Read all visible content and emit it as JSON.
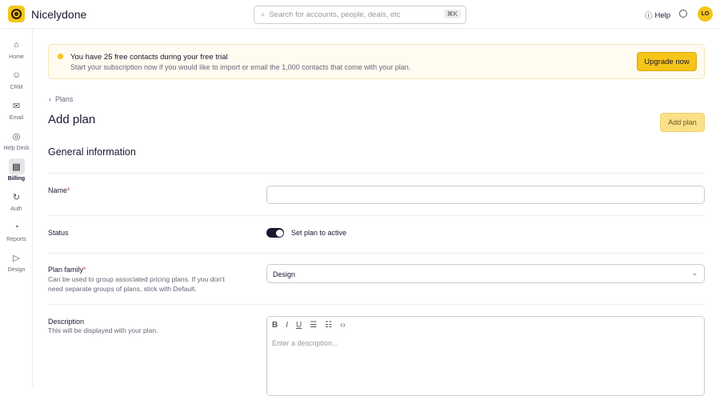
{
  "header": {
    "brand": "Nicelydone",
    "search_placeholder": "Search for accounts, people, deals, etc",
    "search_shortcut": "⌘K",
    "help": "Help",
    "avatar": "LO"
  },
  "sidebar": {
    "items": [
      {
        "label": "Home",
        "icon": "⌂"
      },
      {
        "label": "CRM",
        "icon": "☺"
      },
      {
        "label": "Email",
        "icon": "✉"
      },
      {
        "label": "Help Desk",
        "icon": "◎"
      },
      {
        "label": "Billing",
        "icon": "▤"
      },
      {
        "label": "Auth",
        "icon": "↻"
      },
      {
        "label": "Reports",
        "icon": "◔"
      },
      {
        "label": "Design",
        "icon": "▷"
      }
    ],
    "active": "Billing"
  },
  "banner": {
    "title": "You have 25 free contacts during your free trial",
    "text": "Start your subscription now if you would like to import or email the 1,000 contacts that come with your plan.",
    "button": "Upgrade now"
  },
  "breadcrumb": "Plans",
  "page_title": "Add plan",
  "add_button": "Add plan",
  "section": "General information",
  "form": {
    "name_label": "Name",
    "name_value": "",
    "status_label": "Status",
    "status_toggle": "Set plan to active",
    "status_on": true,
    "family_label": "Plan family",
    "family_help": "Can be used to group associated pricing plans. If you don't need separate groups of plans, stick with Default.",
    "family_value": "Design",
    "desc_label": "Description",
    "desc_help": "This will be displayed with your plan.",
    "desc_placeholder": "Enter a description..."
  },
  "colors": {
    "accent": "#f5c518",
    "dark": "#1f1530"
  }
}
